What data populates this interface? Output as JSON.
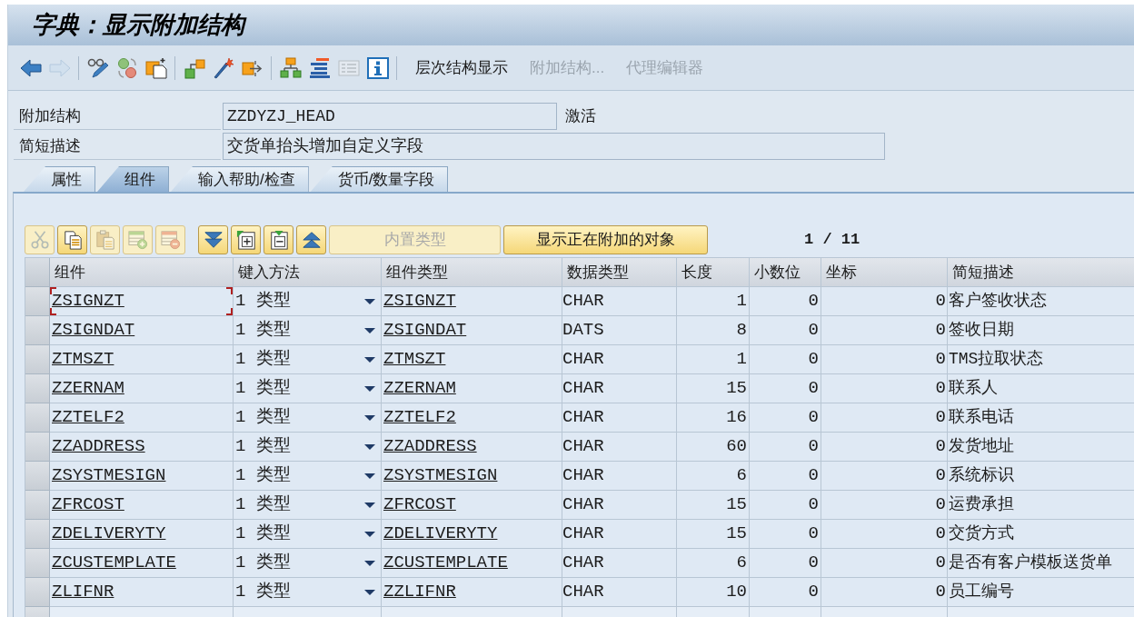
{
  "window": {
    "title": "字典：显示附加结构"
  },
  "toolbar": {
    "icon_buttons": [
      {
        "disabled": false
      },
      {
        "disabled": true
      },
      {
        "disabled": false
      },
      {
        "disabled": false
      },
      {
        "disabled": false
      },
      {
        "disabled": false
      },
      {
        "disabled": false
      },
      {
        "disabled": false
      },
      {
        "disabled": false
      },
      {
        "disabled": false
      },
      {
        "disabled": true
      },
      {
        "disabled": false
      }
    ],
    "text_buttons": [
      {
        "label": "层次结构显示",
        "disabled": false
      },
      {
        "label": "附加结构...",
        "disabled": true
      },
      {
        "label": "代理编辑器",
        "disabled": true
      }
    ]
  },
  "form": {
    "fields": [
      {
        "label": "附加结构",
        "value": "ZZDYZJ_HEAD",
        "status": "激活"
      },
      {
        "label": "简短描述",
        "value": "交货单抬头增加自定义字段"
      }
    ]
  },
  "tabs": [
    {
      "label": "属性",
      "selected": false
    },
    {
      "label": "组件",
      "selected": true
    },
    {
      "label": "输入帮助/检查",
      "selected": false
    },
    {
      "label": "货币/数量字段",
      "selected": false
    }
  ],
  "table_toolbar": {
    "icon_buttons": [
      {
        "disabled": true
      },
      {
        "disabled": false
      },
      {
        "disabled": true
      },
      {
        "disabled": true
      },
      {
        "disabled": true
      },
      {
        "disabled": false
      },
      {
        "disabled": false
      },
      {
        "disabled": false
      },
      {
        "disabled": false
      }
    ],
    "text_buttons": [
      {
        "label": "内置类型",
        "disabled": true
      },
      {
        "label": "显示正在附加的对象",
        "disabled": false
      }
    ],
    "pager": "1 / 11"
  },
  "table": {
    "columns": [
      "组件",
      "键入方法",
      "组件类型",
      "数据类型",
      "长度",
      "小数位",
      "坐标",
      "简短描述"
    ],
    "rows": [
      {
        "component": "ZSIGNZT",
        "entry_method": "1 类型",
        "component_type": "ZSIGNZT",
        "data_type": "CHAR",
        "length": "1",
        "decimals": "0",
        "coordinate": "0",
        "description": "客户签收状态",
        "focused": true
      },
      {
        "component": "ZSIGNDAT",
        "entry_method": "1 类型",
        "component_type": "ZSIGNDAT",
        "data_type": "DATS",
        "length": "8",
        "decimals": "0",
        "coordinate": "0",
        "description": "签收日期",
        "focused": false
      },
      {
        "component": "ZTMSZT",
        "entry_method": "1 类型",
        "component_type": "ZTMSZT",
        "data_type": "CHAR",
        "length": "1",
        "decimals": "0",
        "coordinate": "0",
        "description": "TMS拉取状态",
        "focused": false
      },
      {
        "component": "ZZERNAM",
        "entry_method": "1 类型",
        "component_type": "ZZERNAM",
        "data_type": "CHAR",
        "length": "15",
        "decimals": "0",
        "coordinate": "0",
        "description": "联系人",
        "focused": false
      },
      {
        "component": "ZZTELF2",
        "entry_method": "1 类型",
        "component_type": "ZZTELF2",
        "data_type": "CHAR",
        "length": "16",
        "decimals": "0",
        "coordinate": "0",
        "description": "联系电话",
        "focused": false
      },
      {
        "component": "ZZADDRESS",
        "entry_method": "1 类型",
        "component_type": "ZZADDRESS",
        "data_type": "CHAR",
        "length": "60",
        "decimals": "0",
        "coordinate": "0",
        "description": "发货地址",
        "focused": false
      },
      {
        "component": "ZSYSTMESIGN",
        "entry_method": "1 类型",
        "component_type": "ZSYSTMESIGN",
        "data_type": "CHAR",
        "length": "6",
        "decimals": "0",
        "coordinate": "0",
        "description": "系统标识",
        "focused": false
      },
      {
        "component": "ZFRCOST",
        "entry_method": "1 类型",
        "component_type": "ZFRCOST",
        "data_type": "CHAR",
        "length": "15",
        "decimals": "0",
        "coordinate": "0",
        "description": "运费承担",
        "focused": false
      },
      {
        "component": "ZDELIVERYTY",
        "entry_method": "1 类型",
        "component_type": "ZDELIVERYTY",
        "data_type": "CHAR",
        "length": "15",
        "decimals": "0",
        "coordinate": "0",
        "description": "交货方式",
        "focused": false
      },
      {
        "component": "ZCUSTEMPLATE",
        "entry_method": "1 类型",
        "component_type": "ZCUSTEMPLATE",
        "data_type": "CHAR",
        "length": "6",
        "decimals": "0",
        "coordinate": "0",
        "description": "是否有客户模板送货单",
        "focused": false
      },
      {
        "component": "ZLIFNR",
        "entry_method": "1 类型",
        "component_type": "ZZLIFNR",
        "data_type": "CHAR",
        "length": "10",
        "decimals": "0",
        "coordinate": "0",
        "description": "员工编号",
        "focused": false
      }
    ]
  }
}
